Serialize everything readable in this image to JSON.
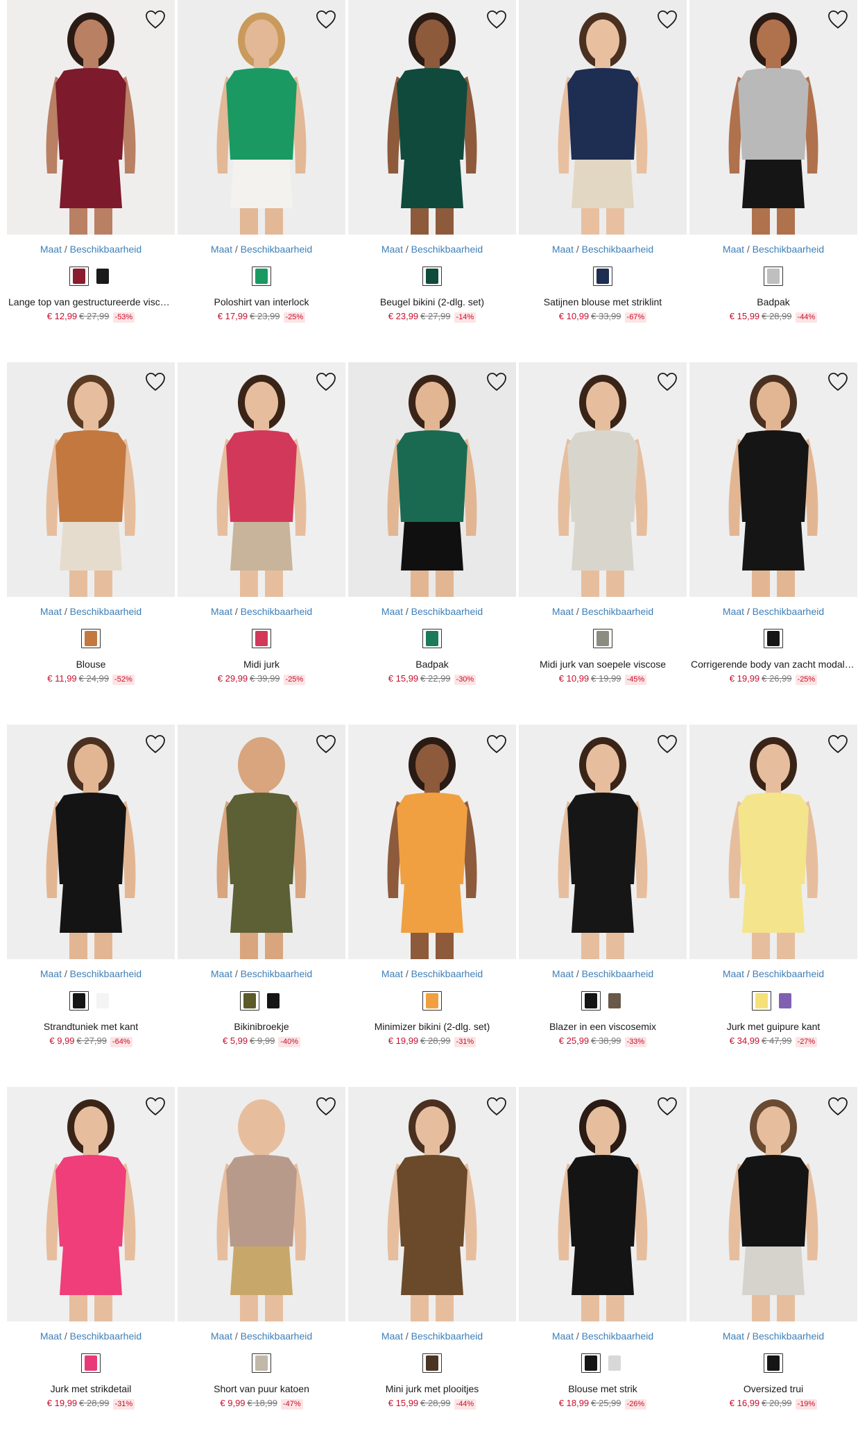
{
  "size_label": "Maat",
  "size_separator": "/",
  "availability_label": "Beschikbaarheid",
  "colors": {
    "accent_link": "#3d7fb8",
    "price": "#c8102e",
    "discount_bg": "#fde4e4"
  },
  "products": [
    {
      "name": "Lange top van gestructureerde viscose",
      "price": "€ 12,99",
      "old_price": "€ 27,99",
      "discount": "-53%",
      "swatches": [
        "#8a1c2e",
        "#1a1a1a"
      ],
      "colors": {
        "bg": "#f0eeed",
        "garment": "#7d1a2c",
        "skin": "#b98064",
        "hair": "#2a1b14",
        "bottom": "#7d1a2c"
      }
    },
    {
      "name": "Poloshirt van interlock",
      "price": "€ 17,99",
      "old_price": "€ 23,99",
      "discount": "-25%",
      "swatches": [
        "#1a9a62"
      ],
      "colors": {
        "bg": "#ededed",
        "garment": "#1a9a62",
        "skin": "#e3b896",
        "hair": "#c99a5b",
        "bottom": "#f4f2ee"
      }
    },
    {
      "name": "Beugel bikini (2-dlg. set)",
      "price": "€ 23,99",
      "old_price": "€ 27,99",
      "discount": "-14%",
      "swatches": [
        "#0f4a3c"
      ],
      "colors": {
        "bg": "#efefef",
        "garment": "#0f4a3c",
        "skin": "#8e5a3c",
        "hair": "#2a1b14",
        "bottom": "#0f4a3c"
      }
    },
    {
      "name": "Satijnen blouse met striklint",
      "price": "€ 10,99",
      "old_price": "€ 33,99",
      "discount": "-67%",
      "swatches": [
        "#1e2d52"
      ],
      "colors": {
        "bg": "#ececec",
        "garment": "#1e2d52",
        "skin": "#e8c0a0",
        "hair": "#4a3020",
        "bottom": "#e2d7c2"
      }
    },
    {
      "name": "Badpak",
      "price": "€ 15,99",
      "old_price": "€ 28,99",
      "discount": "-44%",
      "swatches": [
        "#bfbfbf"
      ],
      "colors": {
        "bg": "#eeeeee",
        "garment": "#b9b9b9",
        "skin": "#b0714d",
        "hair": "#2a1b14",
        "bottom": "#151515"
      }
    },
    {
      "name": "Blouse",
      "price": "€ 11,99",
      "old_price": "€ 24,99",
      "discount": "-52%",
      "swatches": [
        "#c2783f"
      ],
      "colors": {
        "bg": "#ededed",
        "garment": "#c2783f",
        "skin": "#e6be9e",
        "hair": "#5a3a22",
        "bottom": "#e6dccd"
      }
    },
    {
      "name": "Midi jurk",
      "price": "€ 29,99",
      "old_price": "€ 39,99",
      "discount": "-25%",
      "swatches": [
        "#d2385a"
      ],
      "colors": {
        "bg": "#efefef",
        "garment": "#d2385a",
        "skin": "#e6be9e",
        "hair": "#3a2418",
        "bottom": "#c8b49a"
      }
    },
    {
      "name": "Badpak",
      "price": "€ 15,99",
      "old_price": "€ 22,99",
      "discount": "-30%",
      "swatches": [
        "#1a7a5c"
      ],
      "colors": {
        "bg": "#e9e9e9",
        "garment": "#1a6a52",
        "skin": "#e2b692",
        "hair": "#3a2418",
        "bottom": "#101010"
      }
    },
    {
      "name": "Midi jurk van soepele viscose",
      "price": "€ 10,99",
      "old_price": "€ 19,99",
      "discount": "-45%",
      "swatches": [
        "#8c8c80"
      ],
      "colors": {
        "bg": "#eeeeee",
        "garment": "#d8d6cc",
        "skin": "#e6be9e",
        "hair": "#3a2418",
        "bottom": "#d8d6cc"
      }
    },
    {
      "name": "Corrigerende body van zacht modal met kant",
      "price": "€ 19,99",
      "old_price": "€ 26,99",
      "discount": "-25%",
      "swatches": [
        "#151515"
      ],
      "colors": {
        "bg": "#eeeeee",
        "garment": "#151515",
        "skin": "#e3b693",
        "hair": "#4a3020",
        "bottom": "#151515"
      }
    },
    {
      "name": "Strandtuniek met kant",
      "price": "€ 9,99",
      "old_price": "€ 27,99",
      "discount": "-64%",
      "swatches": [
        "#151515",
        "#f4f4f4"
      ],
      "colors": {
        "bg": "#eeeeee",
        "garment": "#141414",
        "skin": "#e3b693",
        "hair": "#4a3020",
        "bottom": "#141414"
      }
    },
    {
      "name": "Bikinibroekje",
      "price": "€ 5,99",
      "old_price": "€ 9,99",
      "discount": "-40%",
      "swatches": [
        "#5a5a2a",
        "#151515"
      ],
      "colors": {
        "bg": "#ececec",
        "garment": "#5d5f34",
        "skin": "#d8a57e",
        "hair": "#d8a57e",
        "bottom": "#5d5f34"
      }
    },
    {
      "name": "Minimizer bikini (2-dlg. set)",
      "price": "€ 19,99",
      "old_price": "€ 28,99",
      "discount": "-31%",
      "swatches": [
        "#f0a040"
      ],
      "colors": {
        "bg": "#efefef",
        "garment": "#f0a040",
        "skin": "#8e5a3c",
        "hair": "#2a1b14",
        "bottom": "#f0a040"
      }
    },
    {
      "name": "Blazer in een viscosemix",
      "price": "€ 25,99",
      "old_price": "€ 38,99",
      "discount": "-33%",
      "swatches": [
        "#151515",
        "#6a5848"
      ],
      "colors": {
        "bg": "#eeeeee",
        "garment": "#161616",
        "skin": "#e6be9e",
        "hair": "#3a2418",
        "bottom": "#161616"
      }
    },
    {
      "name": "Jurk met guipure kant",
      "price": "€ 34,99",
      "old_price": "€ 47,99",
      "discount": "-27%",
      "swatches": [
        "#f6e07a",
        "#8060b0"
      ],
      "colors": {
        "bg": "#eeeeee",
        "garment": "#f4e48c",
        "skin": "#e6be9e",
        "hair": "#3a2418",
        "bottom": "#f4e48c"
      }
    },
    {
      "name": "Jurk met strikdetail",
      "price": "€ 19,99",
      "old_price": "€ 28,99",
      "discount": "-31%",
      "swatches": [
        "#e83a78"
      ],
      "colors": {
        "bg": "#efefef",
        "garment": "#ef3e7a",
        "skin": "#e6be9e",
        "hair": "#3a2418",
        "bottom": "#ef3e7a"
      }
    },
    {
      "name": "Short van puur katoen",
      "price": "€ 9,99",
      "old_price": "€ 18,99",
      "discount": "-47%",
      "swatches": [
        "#c0b8a8"
      ],
      "colors": {
        "bg": "#ededed",
        "garment": "#b89a8a",
        "skin": "#e6be9e",
        "hair": "#e6be9e",
        "bottom": "#c8a86a"
      }
    },
    {
      "name": "Mini jurk met plooitjes",
      "price": "€ 15,99",
      "old_price": "€ 28,99",
      "discount": "-44%",
      "swatches": [
        "#4a3424"
      ],
      "colors": {
        "bg": "#eeeeee",
        "garment": "#6a4a2a",
        "skin": "#e6be9e",
        "hair": "#4a3020",
        "bottom": "#6a4a2a"
      }
    },
    {
      "name": "Blouse met strik",
      "price": "€ 18,99",
      "old_price": "€ 25,99",
      "discount": "-26%",
      "swatches": [
        "#151515",
        "#d8d8d8"
      ],
      "colors": {
        "bg": "#eeeeee",
        "garment": "#141414",
        "skin": "#e6be9e",
        "hair": "#2a1b14",
        "bottom": "#141414"
      }
    },
    {
      "name": "Oversized trui",
      "price": "€ 16,99",
      "old_price": "€ 20,99",
      "discount": "-19%",
      "swatches": [
        "#151515"
      ],
      "colors": {
        "bg": "#eeeeee",
        "garment": "#141414",
        "skin": "#e6be9e",
        "hair": "#6a4a30",
        "bottom": "#d6d2cc"
      }
    }
  ]
}
